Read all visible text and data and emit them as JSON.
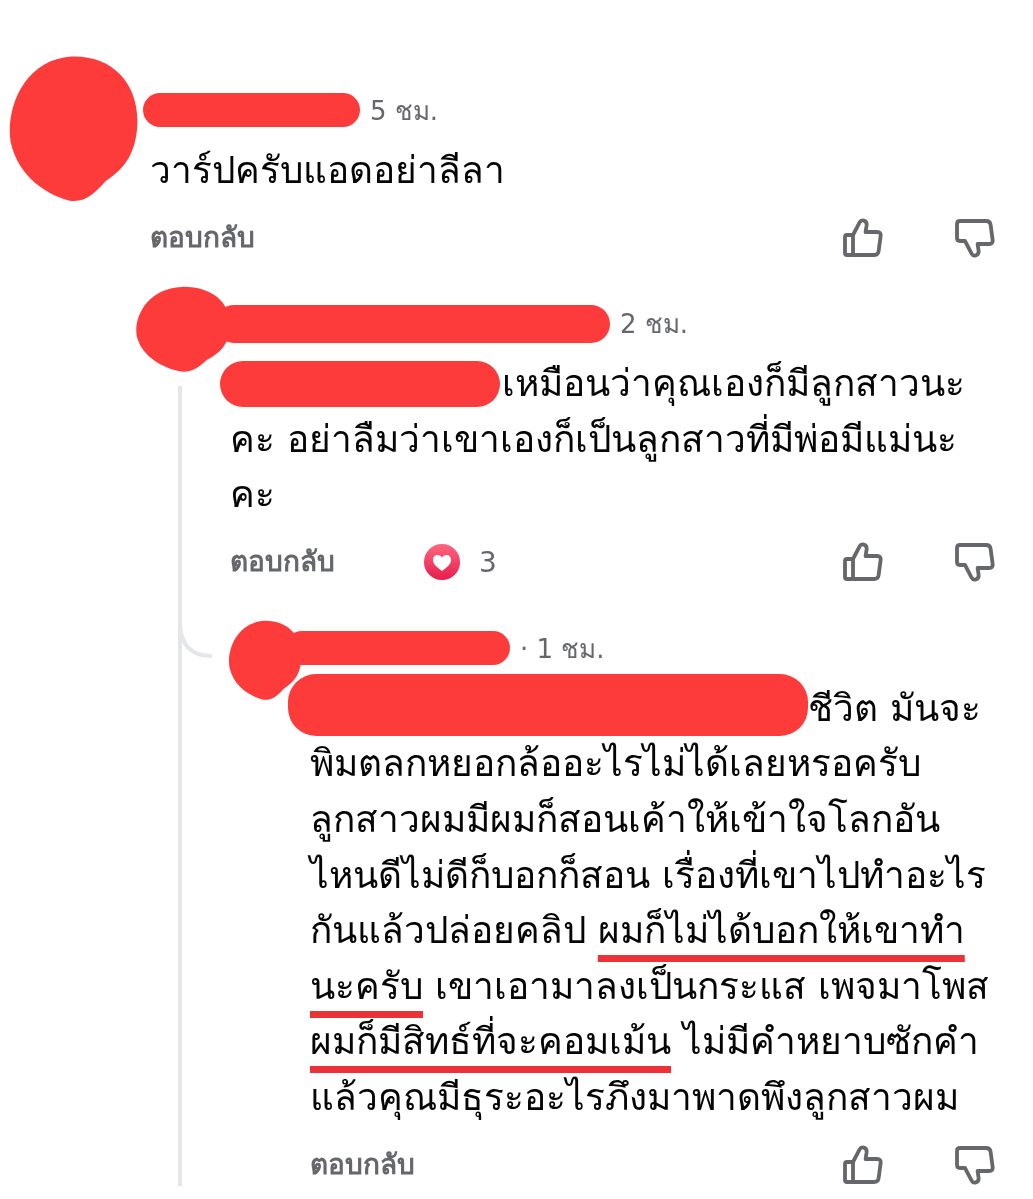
{
  "comments": [
    {
      "author_redacted": true,
      "time": "5 ชม.",
      "lines": [
        [
          {
            "text": "วาร์ปครับแอดอย่าลีลา",
            "underlined": false
          }
        ]
      ],
      "reply_label": "ตอบกลับ",
      "children": [
        {
          "author_redacted": true,
          "time": "2 ชม.",
          "mention_redacted": true,
          "lines": [
            [
              {
                "text": "เหมือนว่าคุณเองก็มีลูกสาวนะ",
                "underlined": false
              }
            ],
            [
              {
                "text": "คะ อย่าลืมว่าเขาเองก็เป็นลูกสาวที่มีพ่อมีแม่นะ",
                "underlined": false
              }
            ],
            [
              {
                "text": "คะ",
                "underlined": false
              }
            ]
          ],
          "reply_label": "ตอบกลับ",
          "reaction": {
            "kind": "heart",
            "count": "3"
          },
          "children": [
            {
              "author_redacted": true,
              "time": "· 1 ชม.",
              "mention_redacted": true,
              "lines": [
                [
                  {
                    "text": "ชีวิต มันจะ",
                    "underlined": false
                  }
                ],
                [
                  {
                    "text": "พิมตลกหยอกล้ออะไรไม่ได้เลยหรอครับ",
                    "underlined": false
                  }
                ],
                [
                  {
                    "text": "ลูกสาวผมมีผมก็สอนเค้าให้เข้าใจโลกอัน",
                    "underlined": false
                  }
                ],
                [
                  {
                    "text": "ไหนดีไม่ดีก็บอกก็สอน เรื่องที่เขาไปทำอะไร",
                    "underlined": false
                  }
                ],
                [
                  {
                    "text": "กันแล้วปล่อยคลิป ",
                    "underlined": false
                  },
                  {
                    "text": "ผมก็ไม่ได้บอกให้เขาทำ",
                    "underlined": true
                  }
                ],
                [
                  {
                    "text": "นะครับ",
                    "underlined": true
                  },
                  {
                    "text": " เขาเอามาลงเป็นกระแส เพจมาโพส",
                    "underlined": false
                  }
                ],
                [
                  {
                    "text": "ผมก็มีสิทธ์ที่จะคอมเม้น",
                    "underlined": true
                  },
                  {
                    "text": " ไม่มีคำหยาบซักคำ",
                    "underlined": false
                  }
                ],
                [
                  {
                    "text": "แล้วคุณมีธุระอะไรภึงมาพาดพึงลูกสาวผม",
                    "underlined": false
                  }
                ]
              ],
              "reply_label": "ตอบกลับ"
            }
          ]
        }
      ]
    }
  ]
}
